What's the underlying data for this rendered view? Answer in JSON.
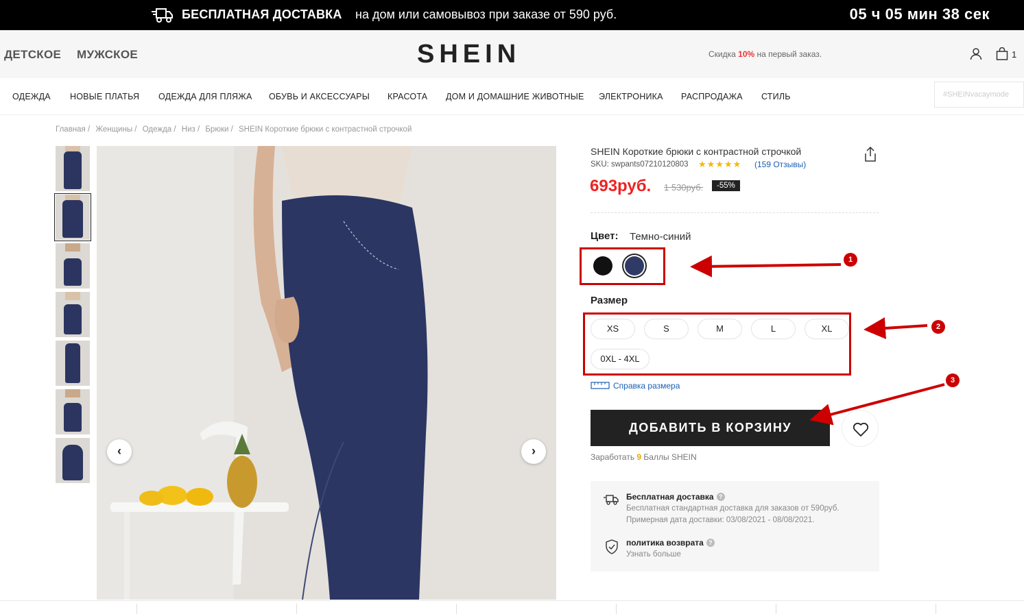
{
  "topbar": {
    "shipping_title": "БЕСПЛАТНАЯ ДОСТАВКА",
    "shipping_text": "на дом или самовывоз при заказе от 590 руб.",
    "timer": "05 ч 05 мин 38 сек"
  },
  "header": {
    "categories": [
      "ДЕТСКОЕ",
      "МУЖСКОЕ"
    ],
    "logo": "SHEIN",
    "promo_prefix": "Скидка ",
    "promo_highlight": "10%",
    "promo_suffix": " на первый заказ.",
    "cart_count": "1"
  },
  "nav": {
    "items": [
      "ОДЕЖДА",
      "НОВЫЕ ПЛАТЬЯ",
      "ОДЕЖДА ДЛЯ ПЛЯЖА",
      "ОБУВЬ И АКСЕССУАРЫ",
      "КРАСОТА",
      "ДОМ И ДОМАШНИЕ ЖИВОТНЫЕ",
      "ЭЛЕКТРОНИКА",
      "РАСПРОДАЖА",
      "СТИЛЬ"
    ],
    "hashtag_placeholder": "#SHEINvacaymode"
  },
  "breadcrumb": [
    "Главная /",
    "Женщины /",
    "Одежда /",
    "Низ /",
    "Брюки /",
    "SHEIN Короткие брюки с контрастной строчкой"
  ],
  "gallery": {
    "thumb_count": 7,
    "selected_thumb": 1,
    "prev_glyph": "‹",
    "next_glyph": "›"
  },
  "product": {
    "title": "SHEIN Короткие брюки с контрастной строчкой",
    "sku": "SKU: swpants07210120803",
    "rating_stars": "★★★★★",
    "reviews": "(159 Отзывы)",
    "price": "693руб.",
    "old_price": "1 530руб.",
    "discount": "-55%",
    "color_label": "Цвет:",
    "color_value": "Темно-синий",
    "swatch_colors": [
      "#111111",
      "#2f3b66"
    ],
    "size_label": "Размер",
    "sizes": [
      "XS",
      "S",
      "M",
      "L",
      "XL",
      "0XL - 4XL"
    ],
    "size_guide": "Справка размера",
    "add_to_cart": "ДОБАВИТЬ В КОРЗИНУ",
    "points_prefix": "Заработать ",
    "points_value": "9",
    "points_suffix": " Баллы SHEIN"
  },
  "info": {
    "shipping_title": "Бесплатная доставка",
    "shipping_line1": "Бесплатная стандартная доставка для заказов от 590руб.",
    "shipping_line2": "Примерная дата доставки: 03/08/2021 - 08/08/2021.",
    "return_title": "политика возврата",
    "return_link": "Узнать больше"
  },
  "annotations": [
    "1",
    "2",
    "3"
  ],
  "colors": {
    "price_red": "#e22",
    "annotation_red": "#c00",
    "link_blue": "#1a5fb4"
  }
}
